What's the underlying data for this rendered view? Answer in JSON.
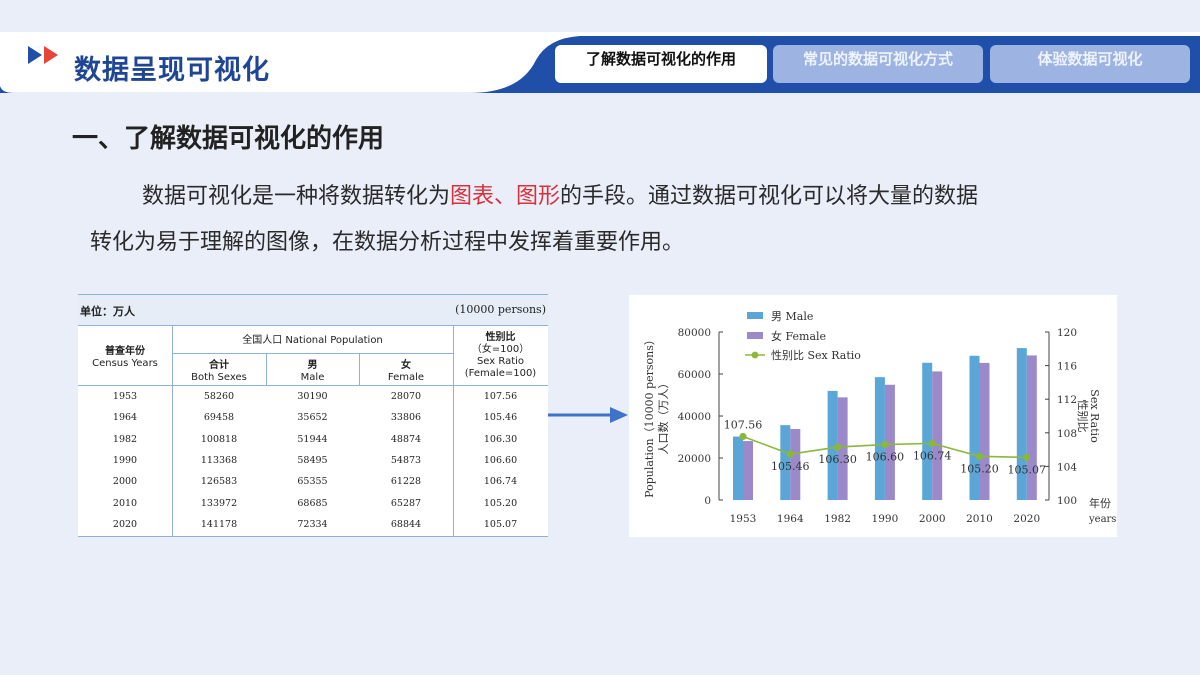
{
  "header": {
    "title": "数据呈现可视化",
    "tabs": [
      {
        "label": "了解数据可视化的作用",
        "active": true
      },
      {
        "label": "常见的数据可视化方式",
        "active": false
      },
      {
        "label": "体验数据可视化",
        "active": false
      }
    ]
  },
  "section": {
    "title": "一、了解数据可视化的作用",
    "para_part1": "数据可视化是一种将数据转化为",
    "para_highlight": "图表、图形",
    "para_part2": "的手段。通过数据可视化可以将大量的数据",
    "para_line2": "转化为易于理解的图像，在数据分析过程中发挥着重要作用。"
  },
  "table": {
    "unit_left": "单位：万人",
    "unit_right": "(10000 persons)",
    "col_year_cn": "普查年份",
    "col_year_en": "Census Years",
    "group_header": "全国人口 National Population",
    "col_total_cn": "合计",
    "col_total_en": "Both Sexes",
    "col_male_cn": "男",
    "col_male_en": "Male",
    "col_female_cn": "女",
    "col_female_en": "Female",
    "col_ratio_cn": "性别比",
    "col_ratio_cn2": "（女=100）",
    "col_ratio_en": "Sex Ratio",
    "col_ratio_en2": "(Female=100)",
    "rows": [
      [
        "1953",
        "58260",
        "30190",
        "28070",
        "107.56"
      ],
      [
        "1964",
        "69458",
        "35652",
        "33806",
        "105.46"
      ],
      [
        "1982",
        "100818",
        "51944",
        "48874",
        "106.30"
      ],
      [
        "1990",
        "113368",
        "58495",
        "54873",
        "106.60"
      ],
      [
        "2000",
        "126583",
        "65355",
        "61228",
        "106.74"
      ],
      [
        "2010",
        "133972",
        "68685",
        "65287",
        "105.20"
      ],
      [
        "2020",
        "141178",
        "72334",
        "68844",
        "105.07"
      ]
    ]
  },
  "colors": {
    "male": "#5aa6d6",
    "female": "#9b89c9",
    "ratio": "#8ab83a",
    "header_blue": "#1e4694",
    "highlight": "#d9303a"
  },
  "chart_data": {
    "type": "bar",
    "categories": [
      "1953",
      "1964",
      "1982",
      "1990",
      "2000",
      "2010",
      "2020"
    ],
    "series": [
      {
        "name": "男 Male",
        "axis": "left",
        "values": [
          30190,
          35652,
          51944,
          58495,
          65355,
          68685,
          72334
        ]
      },
      {
        "name": "女 Female",
        "axis": "left",
        "values": [
          28070,
          33806,
          48874,
          54873,
          61228,
          65287,
          68844
        ]
      },
      {
        "name": "性别比 Sex Ratio",
        "type": "line",
        "axis": "right",
        "values": [
          107.56,
          105.46,
          106.3,
          106.6,
          106.74,
          105.2,
          105.07
        ]
      }
    ],
    "data_labels": [
      "107.56",
      "105.46",
      "106.30",
      "106.60",
      "106.74",
      "105.20",
      "105.07"
    ],
    "ylabel_left_en": "Population（10000 persons）",
    "ylabel_left_cn": "人口数（万人）",
    "ylabel_right_en": "Sex Ratio",
    "ylabel_right_cn": "性别比",
    "xlabel_cn": "年份",
    "xlabel_en": "years",
    "ylim_left": [
      0,
      80000
    ],
    "yticks_left": [
      "0",
      "20000",
      "40000",
      "60000",
      "80000"
    ],
    "ylim_right": [
      100,
      120
    ],
    "yticks_right": [
      "100",
      "104",
      "108",
      "112",
      "116",
      "120"
    ],
    "legend_position": "top-left",
    "grid": false
  }
}
